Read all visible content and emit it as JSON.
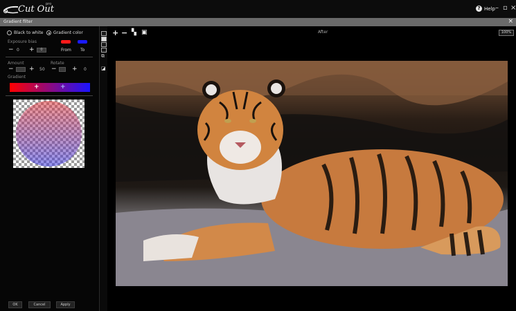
{
  "app": {
    "name": "Cut Out",
    "badge": "pro",
    "help_label": "Help",
    "window_controls": {
      "minimize": "minimize-icon",
      "restore": "restore-icon",
      "close": "close-icon"
    }
  },
  "dialog": {
    "title": "Gradient filter"
  },
  "left": {
    "mode_options": [
      {
        "label": "Black to white",
        "selected": false
      },
      {
        "label": "Gradient color",
        "selected": true
      }
    ],
    "exposure_label": "Exposure bias",
    "exposure_value": "0",
    "exposure_field": "0",
    "from_label": "From",
    "to_label": "To",
    "from_color": "#ff1a1a",
    "to_color": "#1a1aff",
    "amount_label": "Amount",
    "amount_value": "50",
    "rotate_label": "Rotate",
    "rotate_value": "0",
    "gradient_label": "Gradient",
    "buttons": {
      "ok": "OK",
      "cancel": "Cancel",
      "apply": "Apply"
    }
  },
  "canvas_toolbar": {
    "view_label": "After",
    "zoom": "100%",
    "icons": [
      "zoom-in-icon",
      "zoom-out-icon",
      "fit-window-icon",
      "actual-size-icon"
    ]
  },
  "tools": [
    "before-view-icon",
    "after-view-icon",
    "split-view-icon",
    "compare-view-icon",
    "layers-icon",
    "paint-bucket-icon"
  ]
}
